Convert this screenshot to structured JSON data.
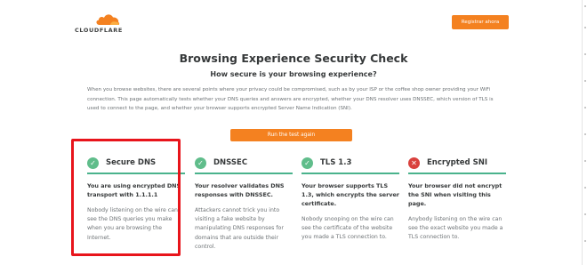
{
  "header": {
    "logo_text": "CLOUDFLARE",
    "register_label": "Registrar ahora"
  },
  "main": {
    "title": "Browsing Experience Security Check",
    "subtitle": "How secure is your browsing experience?",
    "intro": "When you browse websites, there are several points where your privacy could be compromised, such as by your ISP or the coffee shop owner providing your WiFi connection. This page automatically tests whether your DNS queries and answers are encrypted, whether your DNS resolver uses DNSSEC, which version of TLS is used to connect to the page, and whether your browser supports encrypted Server Name Indication (SNI).",
    "run_label": "Run the test again"
  },
  "cards": [
    {
      "status": "ok",
      "icon": "check-icon",
      "title": "Secure DNS",
      "lead": "You are using encrypted DNS transport with 1.1.1.1",
      "desc": "Nobody listening on the wire can see the DNS queries you make when you are browsing the Internet."
    },
    {
      "status": "ok",
      "icon": "check-icon",
      "title": "DNSSEC",
      "lead": "Your resolver validates DNS responses with DNSSEC.",
      "desc": "Attackers cannot trick you into visiting a fake website by manipulating DNS responses for domains that are outside their control."
    },
    {
      "status": "ok",
      "icon": "check-icon",
      "title": "TLS 1.3",
      "lead": "Your browser supports TLS 1.3, which encrypts the server certificate.",
      "desc": "Nobody snooping on the wire can see the certificate of the website you made a TLS connection to."
    },
    {
      "status": "bad",
      "icon": "cross-icon",
      "title": "Encrypted SNI",
      "lead": "Your browser did not encrypt the SNI when visiting this page.",
      "desc": "Anybody listening on the wire can see the exact website you made a TLS connection to."
    }
  ],
  "colors": {
    "accent": "#f48120",
    "ok": "#60bd8b",
    "bad": "#d9413d",
    "highlight": "#e8141b"
  }
}
